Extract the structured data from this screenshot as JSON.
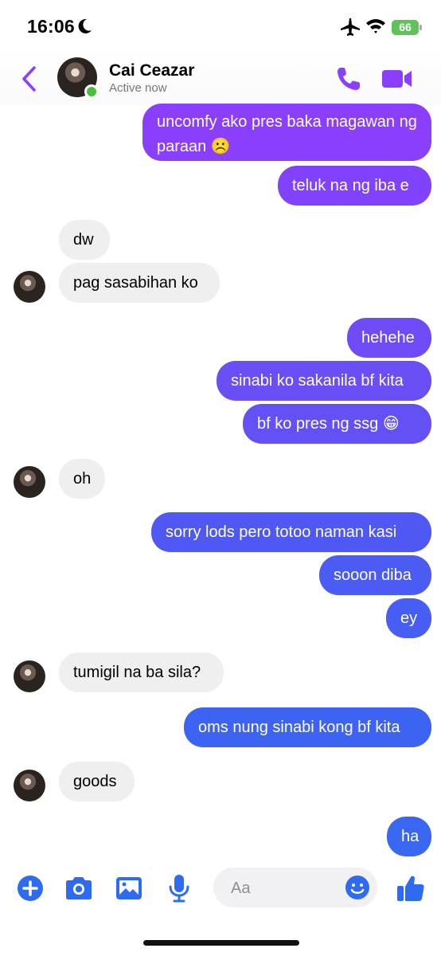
{
  "status_bar": {
    "time": "16:06",
    "battery": "66",
    "icons": [
      "moon-icon",
      "airplane-icon",
      "wifi-icon",
      "battery-icon"
    ]
  },
  "header": {
    "contact_name": "Cai Ceazar",
    "contact_status": "Active now",
    "icons": [
      "back-chevron-icon",
      "phone-icon",
      "video-camera-icon"
    ],
    "accent_color": "#8a3ffc"
  },
  "messages": [
    {
      "from": "me",
      "text": "uncomfy ako pres baka magawan ng paraan ☹️"
    },
    {
      "from": "me",
      "text": "teluk na ng iba e"
    },
    {
      "from": "them",
      "text": "dw"
    },
    {
      "from": "them",
      "text": "pag sasabihan ko"
    },
    {
      "from": "me",
      "text": "hehehe"
    },
    {
      "from": "me",
      "text": "sinabi ko sakanila bf kita"
    },
    {
      "from": "me",
      "text": "bf ko pres ng ssg 😁"
    },
    {
      "from": "them",
      "text": "oh"
    },
    {
      "from": "me",
      "text": "sorry lods pero totoo naman kasi"
    },
    {
      "from": "me",
      "text": "sooon diba"
    },
    {
      "from": "me",
      "text": "ey"
    },
    {
      "from": "them",
      "text": "tumigil na ba sila?"
    },
    {
      "from": "me",
      "text": "oms nung sinabi kong bf kita"
    },
    {
      "from": "them",
      "text": "goods"
    },
    {
      "from": "me",
      "text": "ha"
    }
  ],
  "composer": {
    "placeholder": "Aa",
    "icons": [
      "plus-icon",
      "camera-icon",
      "image-icon",
      "microphone-icon",
      "emoji-icon",
      "thumbs-up-icon"
    ],
    "accent_color": "#2f6bf0"
  },
  "colors": {
    "incoming_bubble": "#efefef",
    "outgoing_top": "#8a3ffc",
    "outgoing_bottom": "#3a67f2"
  }
}
